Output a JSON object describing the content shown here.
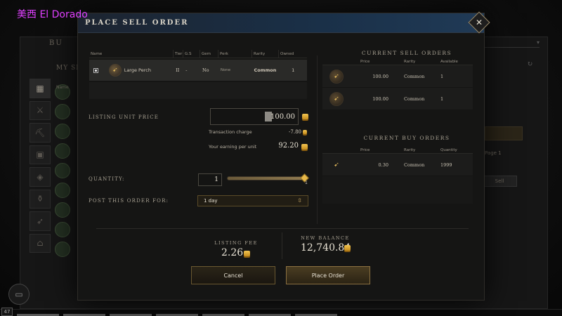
{
  "watermark": "美西 El Dorado",
  "background": {
    "header": "BU",
    "subheader": "MY SEL",
    "column_name": "Name",
    "page_info": "Page 1",
    "sell_button": "Sell",
    "level_badge": "47"
  },
  "dialog": {
    "title": "PLACE SELL ORDER",
    "close_label": "✕"
  },
  "item_table": {
    "columns": [
      "Name",
      "Tier",
      "G.S",
      "Gem",
      "Perk",
      "Rarity",
      "Owned"
    ],
    "row": {
      "name": "Large Perch",
      "tier": "II",
      "gs": "-",
      "gem": "No",
      "perk": "None",
      "rarity": "Common",
      "owned": "1"
    }
  },
  "current_sell_orders": {
    "title": "CURRENT SELL ORDERS",
    "columns": [
      "Price",
      "Rarity",
      "Available"
    ],
    "rows": [
      {
        "price": "100.00",
        "rarity": "Common",
        "available": "1"
      },
      {
        "price": "100.00",
        "rarity": "Common",
        "available": "1"
      }
    ]
  },
  "current_buy_orders": {
    "title": "CURRENT BUY ORDERS",
    "columns": [
      "Price",
      "Rarity",
      "Quantity"
    ],
    "rows": [
      {
        "price": "0.30",
        "rarity": "Common",
        "quantity": "1999"
      }
    ]
  },
  "listing": {
    "price_label": "LISTING UNIT PRICE",
    "price_value": "100.00",
    "transaction_label": "Transaction charge",
    "transaction_value": "-7.80",
    "earning_label": "Your earning per unit",
    "earning_value": "92.20"
  },
  "quantity": {
    "label": "QUANTITY:",
    "value": "1",
    "max": "1",
    "slider_fraction": 1.0
  },
  "duration": {
    "label": "POST THIS ORDER FOR:",
    "selected": "1 day"
  },
  "summary": {
    "listing_fee_label": "LISTING FEE",
    "listing_fee_value": "2.26",
    "new_balance_label": "NEW BALANCE",
    "new_balance_value": "12,740.84"
  },
  "buttons": {
    "cancel": "Cancel",
    "place_order": "Place Order"
  },
  "icons": {
    "item": "fish-icon",
    "coin": "coin-icon",
    "close": "close-icon",
    "dropdown": "chevron-down-icon"
  },
  "colors": {
    "accent_gold": "#e7b84a",
    "title_bar": "#1a3048",
    "watermark": "#e040ff"
  }
}
